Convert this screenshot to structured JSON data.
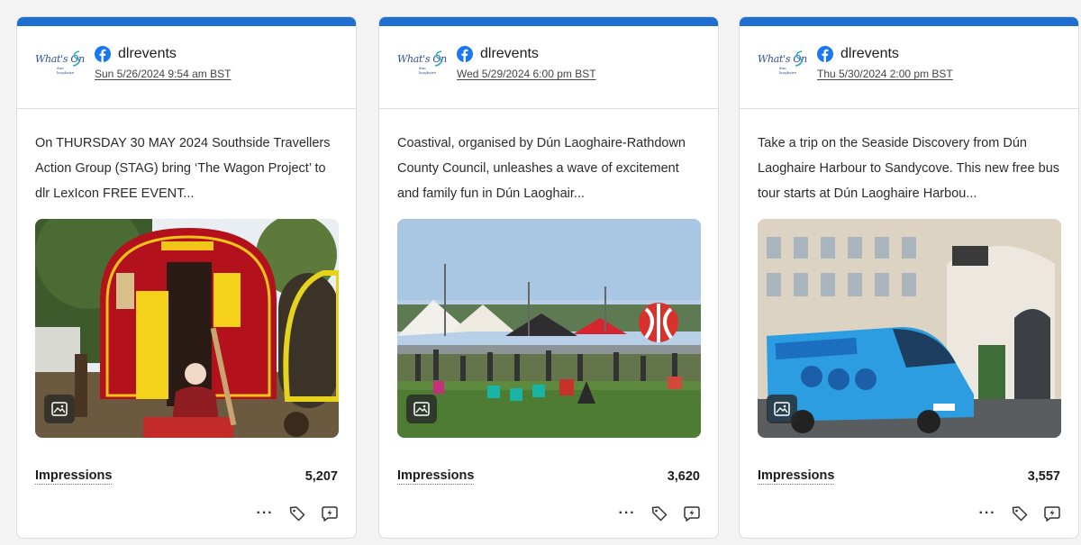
{
  "colors": {
    "accent_bar": "#1f6fd1",
    "facebook": "#1877f2"
  },
  "logo_text": "What's On",
  "logo_sub": "dun laoghaire",
  "metric_label": "Impressions",
  "actions": [
    "more-icon",
    "tag-icon",
    "comment-icon"
  ],
  "more_glyph": "···",
  "cards": [
    {
      "account": "dlrevents",
      "timestamp": "Sun 5/26/2024 9:54 am BST",
      "text": "On THURSDAY 30 MAY 2024 Southside Travellers Action Group (STAG) bring ‘The Wagon Project’ to dlr LexIcon FREE EVENT...",
      "impressions": "5,207"
    },
    {
      "account": "dlrevents",
      "timestamp": "Wed 5/29/2024 6:00 pm BST",
      "text": "Coastival, organised by Dún Laoghaire-Rathdown County Council, unleashes a wave of excitement and family fun in Dún Laoghair...",
      "impressions": "3,620"
    },
    {
      "account": "dlrevents",
      "timestamp": "Thu 5/30/2024 2:00 pm BST",
      "text": "Take a trip on the Seaside Discovery from Dún Laoghaire Harbour to Sandycove. This new free bus tour starts at Dún Laoghaire Harbou...",
      "impressions": "3,557"
    }
  ]
}
